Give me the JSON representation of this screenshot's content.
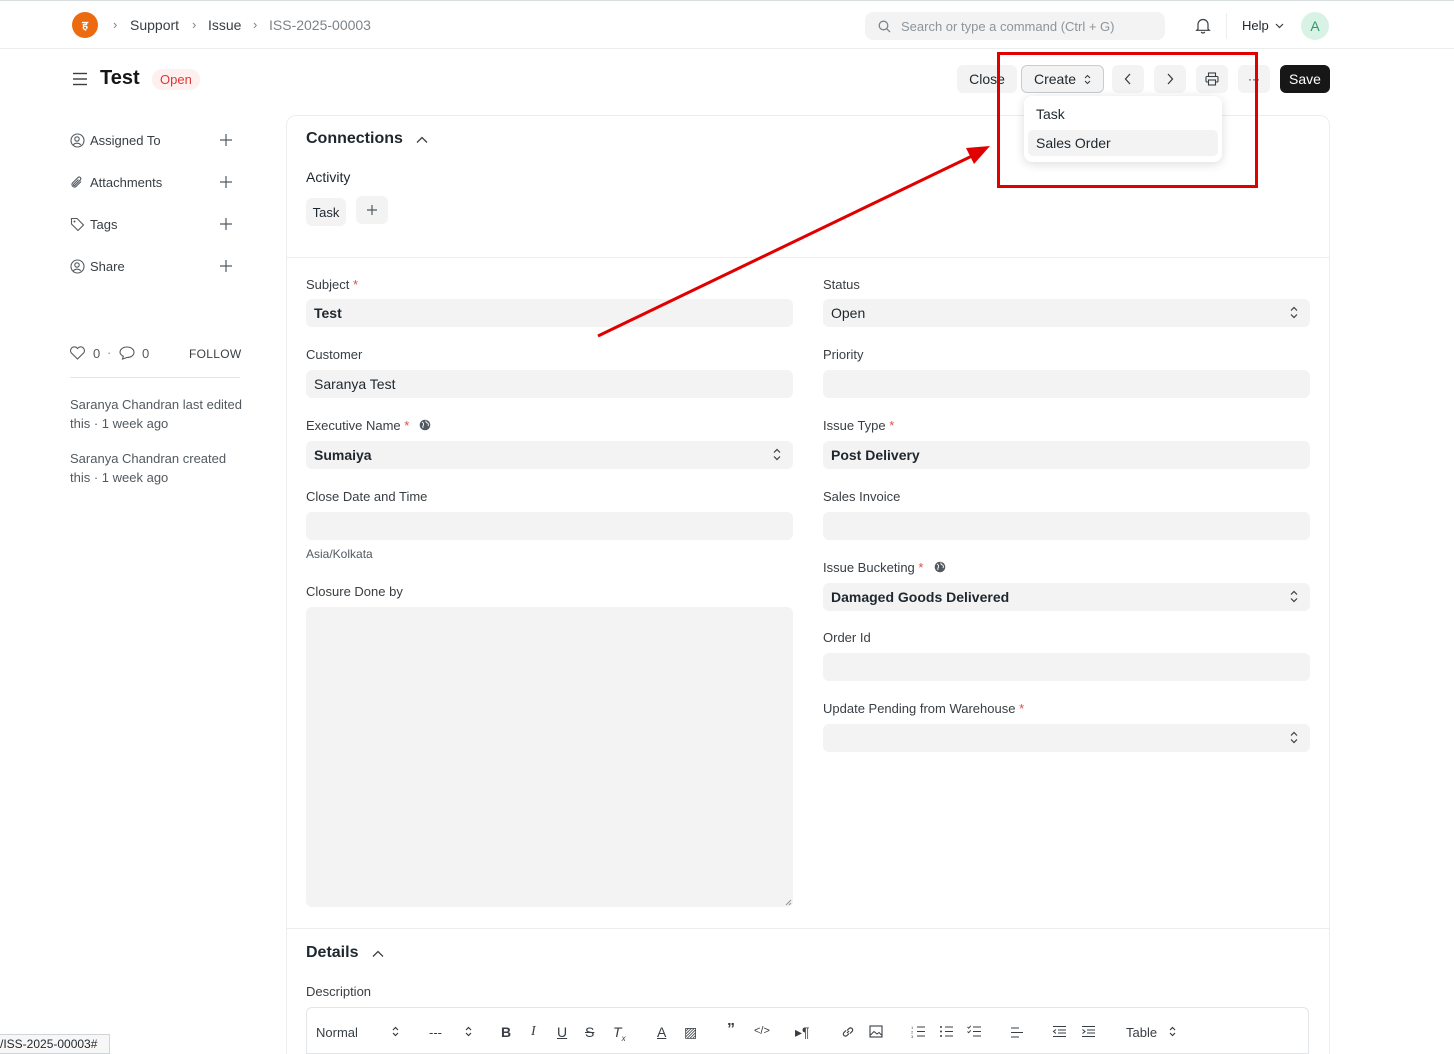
{
  "navbar": {
    "logo_text": "ह",
    "breadcrumbs": [
      "Support",
      "Issue",
      "ISS-2025-00003"
    ],
    "search_placeholder": "Search or type a command (Ctrl + G)",
    "help_label": "Help",
    "avatar_initial": "A"
  },
  "page": {
    "title": "Test",
    "status": "Open"
  },
  "actions": {
    "close_label": "Close",
    "create_label": "Create",
    "save_label": "Save",
    "more_label": "···"
  },
  "create_menu": {
    "items": [
      "Task",
      "Sales Order"
    ],
    "hovered": "Sales Order"
  },
  "sidebar": {
    "items": [
      {
        "label": "Assigned To",
        "icon": "user-plus-icon"
      },
      {
        "label": "Attachments",
        "icon": "paperclip-icon"
      },
      {
        "label": "Tags",
        "icon": "tag-icon"
      },
      {
        "label": "Share",
        "icon": "share-user-icon"
      }
    ],
    "likes": "0",
    "comments": "0",
    "follow_label": "FOLLOW",
    "activity": [
      "Saranya Chandran last edited this · 1 week ago",
      "Saranya Chandran created this · 1 week ago"
    ]
  },
  "connections": {
    "title": "Connections",
    "group_label": "Activity",
    "chip": "Task"
  },
  "form": {
    "subject": {
      "label": "Subject",
      "value": "Test"
    },
    "customer": {
      "label": "Customer",
      "value": "Saranya Test"
    },
    "executive_name": {
      "label": "Executive Name",
      "value": "Sumaiya"
    },
    "close_date": {
      "label": "Close Date and Time",
      "value": "",
      "timezone": "Asia/Kolkata"
    },
    "closure_done_by": {
      "label": "Closure Done by",
      "value": ""
    },
    "status": {
      "label": "Status",
      "value": "Open"
    },
    "priority": {
      "label": "Priority",
      "value": ""
    },
    "issue_type": {
      "label": "Issue Type",
      "value": "Post Delivery"
    },
    "sales_invoice": {
      "label": "Sales Invoice",
      "value": ""
    },
    "issue_bucketing": {
      "label": "Issue Bucketing",
      "value": "Damaged Goods Delivered"
    },
    "order_id": {
      "label": "Order Id",
      "value": ""
    },
    "update_pending": {
      "label": "Update Pending from Warehouse",
      "value": ""
    }
  },
  "details": {
    "title": "Details",
    "description_label": "Description",
    "toolbar": {
      "style_select": "Normal",
      "size_select": "---",
      "table_label": "Table"
    }
  },
  "statusbar": {
    "url": "/ISS-2025-00003#"
  },
  "colors": {
    "annotation": "#e00000",
    "brand": "#ec6a10",
    "badge_red": "#e03636"
  }
}
